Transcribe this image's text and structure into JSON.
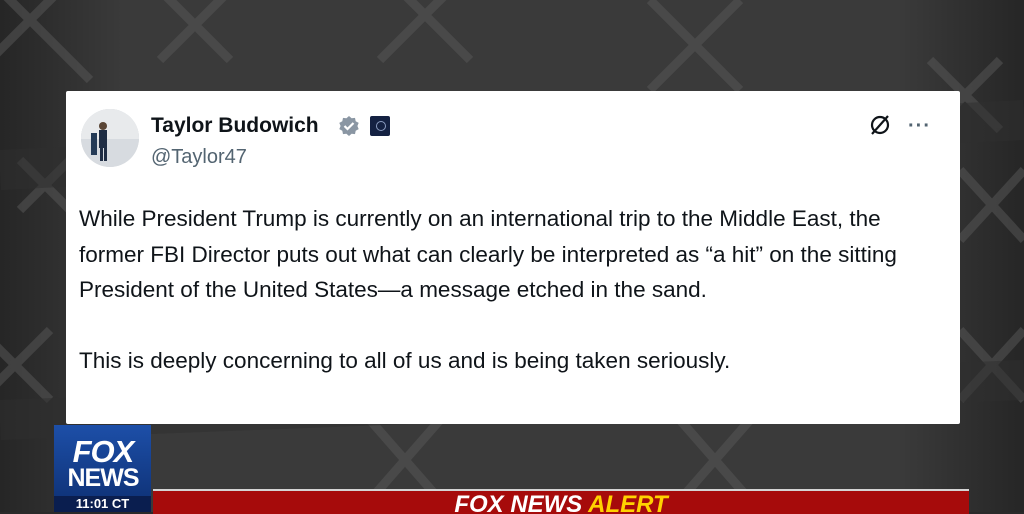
{
  "tweet": {
    "author_name": "Taylor Budowich",
    "author_handle": "@Taylor47",
    "verified": true,
    "paragraphs": [
      "While President Trump is currently on an international trip to the Middle East, the former FBI Director puts out what can clearly be interpreted as “a hit” on the sitting President of the United States—a message etched in the sand.",
      "This is deeply concerning to all of us and is being taken seriously."
    ],
    "more_label": "···"
  },
  "broadcast": {
    "logo_top": "FOX",
    "logo_bottom": "NEWS",
    "time": "11:01 CT",
    "alert_prefix": "FOX NEWS",
    "alert_word": "ALERT"
  },
  "colors": {
    "card_bg": "#ffffff",
    "verified_blue": "#1d9bf0",
    "alert_red": "#a60b0b",
    "alert_yellow": "#ffd200",
    "fox_blue": "#1d4fa8"
  },
  "icons": [
    "verified-icon",
    "affiliate-badge-icon",
    "grok-icon",
    "more-icon",
    "x-logo-icon"
  ]
}
